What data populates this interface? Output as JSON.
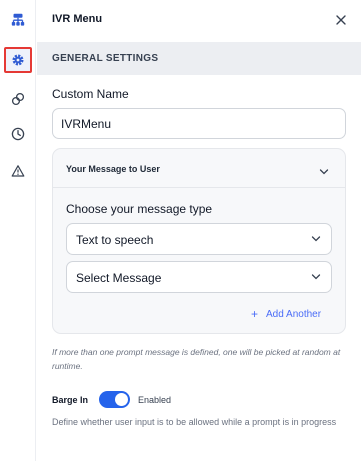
{
  "sidebar": {
    "icons": [
      {
        "name": "flow-icon",
        "active": false
      },
      {
        "name": "gear-icon",
        "active": true
      },
      {
        "name": "link-icon",
        "active": false
      },
      {
        "name": "clock-icon",
        "active": false
      },
      {
        "name": "warning-icon",
        "active": false
      }
    ]
  },
  "header": {
    "title": "IVR Menu",
    "close_icon": "close-icon"
  },
  "section": {
    "title": "GENERAL SETTINGS"
  },
  "custom_name": {
    "label": "Custom Name",
    "value": "IVRMenu"
  },
  "message_card": {
    "title": "Your Message to User",
    "type_label": "Choose your message type",
    "type_select": "Text to speech",
    "message_select": "Select Message",
    "add_label": "Add Another",
    "add_icon": "+"
  },
  "prompt_help": "If more than one prompt message is defined, one will be picked at random at runtime.",
  "barge_in": {
    "label": "Barge In",
    "enabled": true,
    "state_text": "Enabled",
    "description": "Define whether user input is to be allowed while a prompt is in progress"
  },
  "colors": {
    "accent": "#2563eb",
    "link": "#4a6cf7",
    "highlight_border": "#e53935",
    "section_bg": "#eceef2"
  }
}
